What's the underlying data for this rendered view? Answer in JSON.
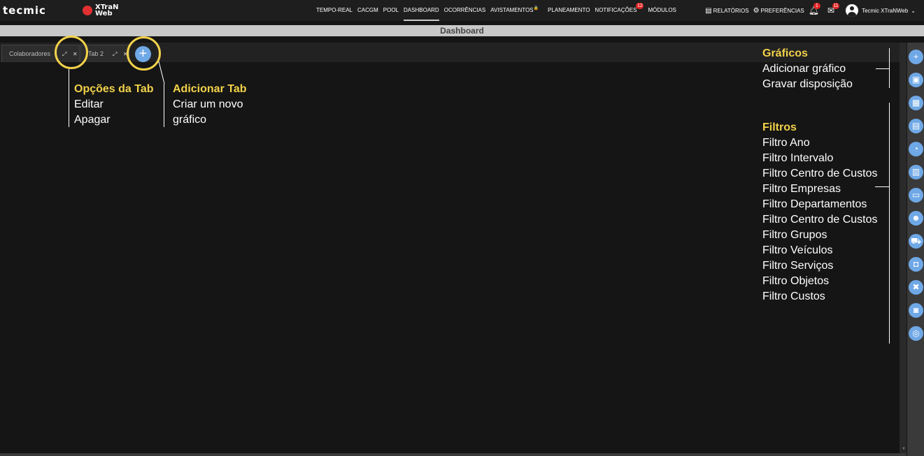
{
  "header": {
    "logo_text": "tecmic",
    "brand_text": "XTraN Web",
    "nav": [
      {
        "label": "TEMPO-REAL"
      },
      {
        "label": "CACGM"
      },
      {
        "label": "POOL"
      },
      {
        "label": "DASHBOARD",
        "active": true
      },
      {
        "label": "OCORRÊNCIAS"
      },
      {
        "label": "AVISTAMENTOS"
      },
      {
        "label": "PLANEAMENTO"
      },
      {
        "label": "NOTIFICAÇÕES",
        "badge": "12"
      },
      {
        "label": "MÓDULOS"
      }
    ],
    "reports_label": "RELATÓRIOS",
    "preferences_label": "PREFERÊNCIAS",
    "alerts_badge": "1",
    "messages_badge": "11",
    "user_name": "Tecmic XTraNWeb"
  },
  "page": {
    "title": "Dashboard"
  },
  "tabs": [
    {
      "label": "Colaboradores"
    },
    {
      "label": "Tab 2"
    }
  ],
  "annotations": {
    "tab_options": {
      "title": "Opções da Tab",
      "lines": [
        "Editar",
        "Apagar"
      ]
    },
    "add_tab": {
      "title": "Adicionar Tab",
      "lines": [
        "Criar um novo",
        "gráfico"
      ]
    },
    "charts": {
      "title": "Gráficos",
      "lines": [
        "Adicionar gráfico",
        "Gravar disposição"
      ]
    },
    "filters": {
      "title": "Filtros",
      "lines": [
        "Filtro Ano",
        "Filtro Intervalo",
        "Filtro Centro de Custos",
        "Filtro Empresas",
        "Filtro Departamentos",
        "Filtro Centro de Custos",
        "Filtro Grupos",
        "Filtro Veículos",
        "Filtro Serviços",
        "Filtro Objetos",
        "Filtro Custos"
      ]
    }
  },
  "sidebar_buttons": [
    {
      "icon": "plus-icon"
    },
    {
      "icon": "save-icon"
    },
    {
      "icon": "calendar-icon"
    },
    {
      "icon": "calendar-range-icon"
    },
    {
      "icon": "cost-center-icon"
    },
    {
      "icon": "building-icon"
    },
    {
      "icon": "department-icon"
    },
    {
      "icon": "user-group-icon"
    },
    {
      "icon": "vehicle-group-icon"
    },
    {
      "icon": "car-icon"
    },
    {
      "icon": "tools-icon"
    },
    {
      "icon": "object-icon"
    },
    {
      "icon": "coins-icon"
    }
  ],
  "colors": {
    "accent": "#f2d24a",
    "button_blue": "#6fa8e6",
    "badge_red": "#e02424"
  }
}
